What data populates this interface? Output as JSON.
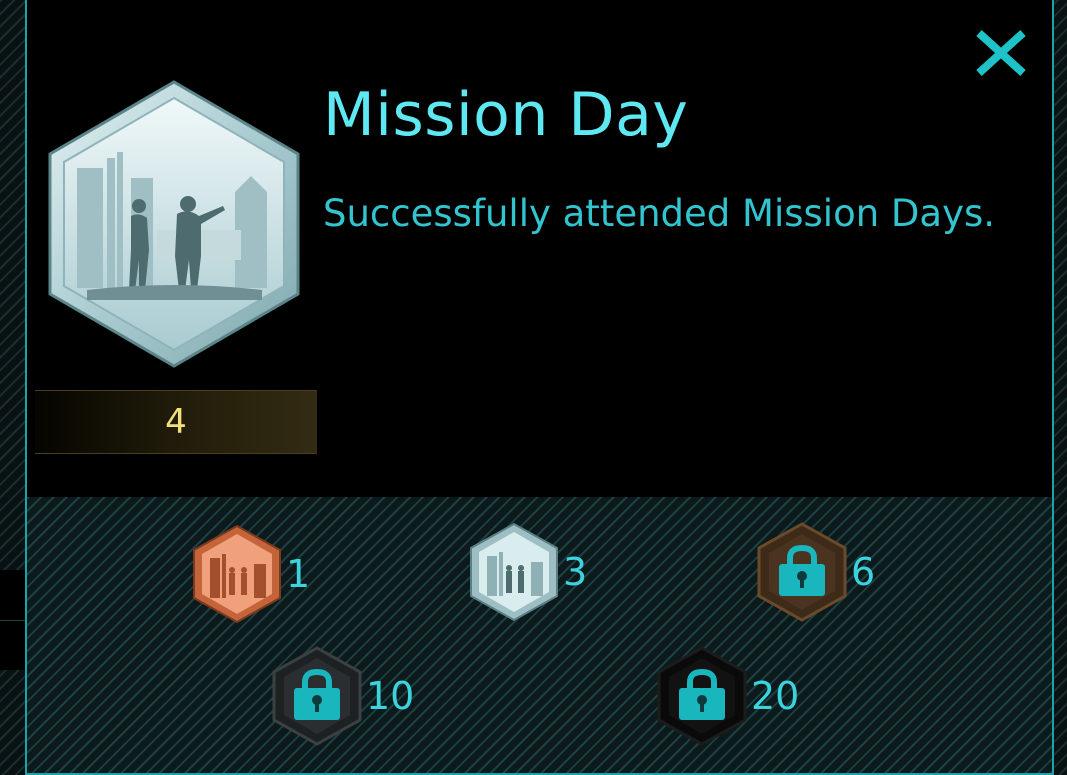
{
  "medal": {
    "title": "Mission Day",
    "description": "Successfully attended Mission Days.",
    "count": "4",
    "current_tier": "silver"
  },
  "tiers": [
    {
      "name": "bronze",
      "value": "1",
      "locked": false
    },
    {
      "name": "silver",
      "value": "3",
      "locked": false
    },
    {
      "name": "gold",
      "value": "6",
      "locked": true
    },
    {
      "name": "platinum",
      "value": "10",
      "locked": true
    },
    {
      "name": "onyx",
      "value": "20",
      "locked": true
    }
  ],
  "icons": {
    "close": "close-icon",
    "lock": "lock-icon"
  },
  "colors": {
    "accent": "#1aa4a9",
    "title": "#5ee8f2",
    "description": "#32c5cf",
    "count": "#f3e07a",
    "bronze": "#e07a4a",
    "silver": "#b9d7db",
    "gold": "#6b4a2a",
    "platinum": "#2e3133",
    "onyx": "#0d0d0d"
  }
}
